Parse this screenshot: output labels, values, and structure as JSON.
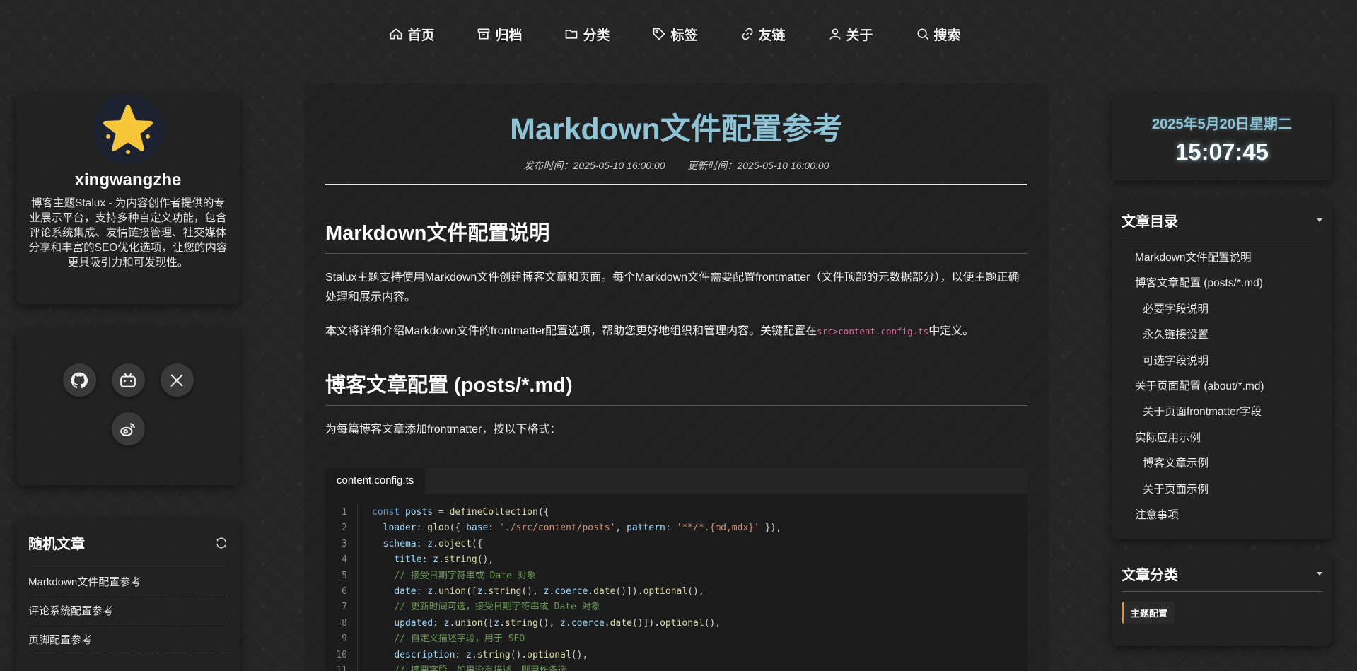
{
  "nav": {
    "items": [
      {
        "label": "首页",
        "icon": "home-icon"
      },
      {
        "label": "归档",
        "icon": "archive-icon"
      },
      {
        "label": "分类",
        "icon": "folder-icon"
      },
      {
        "label": "标签",
        "icon": "tag-icon"
      },
      {
        "label": "友链",
        "icon": "link-icon"
      },
      {
        "label": "关于",
        "icon": "user-icon"
      },
      {
        "label": "搜索",
        "icon": "search-icon"
      }
    ]
  },
  "profile": {
    "name": "xingwangzhe",
    "description": "博客主题Stalux - 为内容创作者提供的专业展示平台，支持多种自定义功能，包含评论系统集成、友情链接管理、社交媒体分享和丰富的SEO优化选项，让您的内容更具吸引力和可发现性。",
    "avatar_color": "#f5c638"
  },
  "social": [
    "github-icon",
    "bilibili-icon",
    "x-icon",
    "weibo-icon"
  ],
  "random": {
    "title": "随机文章",
    "items": [
      "Markdown文件配置参考",
      "评论系统配置参考",
      "页脚配置参考"
    ]
  },
  "post": {
    "title": "Markdown文件配置参考",
    "published": "发布时间：2025-05-10 16:00:00",
    "updated": "更新时间：2025-05-10 16:00:00",
    "h2_1": "Markdown文件配置说明",
    "p1": "Stalux主题支持使用Markdown文件创建博客文章和页面。每个Markdown文件需要配置frontmatter（文件顶部的元数据部分），以便主题正确处理和展示内容。",
    "p2_before": "本文将详细介绍Markdown文件的frontmatter配置选项，帮助您更好地组织和管理内容。关键配置在",
    "p2_code": "src>content.config.ts",
    "p2_after": "中定义。",
    "h2_2": "博客文章配置 (posts/*.md)",
    "p3": "为每篇博客文章添加frontmatter，按以下格式：",
    "code_tab": "content.config.ts"
  },
  "clock": {
    "date": "2025年5月20日星期二",
    "time": "15:07:45"
  },
  "toc": {
    "title": "文章目录",
    "items": [
      {
        "label": "Markdown文件配置说明",
        "level": 2
      },
      {
        "label": "博客文章配置 (posts/*.md)",
        "level": 2
      },
      {
        "label": "必要字段说明",
        "level": 3
      },
      {
        "label": "永久链接设置",
        "level": 3
      },
      {
        "label": "可选字段说明",
        "level": 3
      },
      {
        "label": "关于页面配置 (about/*.md)",
        "level": 2
      },
      {
        "label": "关于页面frontmatter字段",
        "level": 3
      },
      {
        "label": "实际应用示例",
        "level": 2
      },
      {
        "label": "博客文章示例",
        "level": 3
      },
      {
        "label": "关于页面示例",
        "level": 3
      },
      {
        "label": "注意事项",
        "level": 2
      }
    ]
  },
  "categories": {
    "title": "文章分类",
    "items": [
      "主题配置"
    ]
  }
}
